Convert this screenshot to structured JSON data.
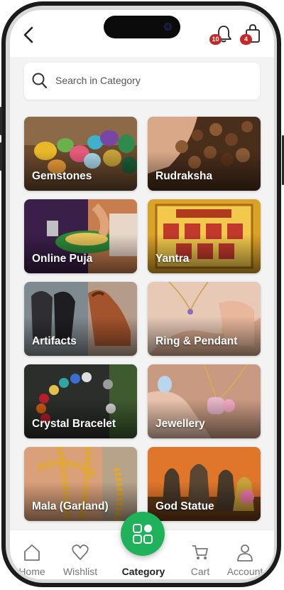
{
  "header": {
    "notification_count": "10",
    "cart_count": "4"
  },
  "search": {
    "placeholder": "Search in Category"
  },
  "categories": [
    {
      "label": "Gemstones",
      "icon": "gemstones-image"
    },
    {
      "label": "Rudraksha",
      "icon": "rudraksha-image"
    },
    {
      "label": "Online Puja",
      "icon": "puja-image"
    },
    {
      "label": "Yantra",
      "icon": "yantra-image"
    },
    {
      "label": "Artifacts",
      "icon": "horses-painting-image"
    },
    {
      "label": "Ring & Pendant",
      "icon": "ring-image"
    },
    {
      "label": "Crystal Bracelet",
      "icon": "bracelet-image"
    },
    {
      "label": "Jewellery",
      "icon": "necklace-image"
    },
    {
      "label": "Mala (Garland)",
      "icon": "mala-image"
    },
    {
      "label": "God Statue",
      "icon": "statue-image"
    }
  ],
  "nav": {
    "home": "Home",
    "wishlist": "Wishlist",
    "category": "Category",
    "cart": "Cart",
    "account": "Account"
  },
  "colors": {
    "accent": "#1fb25a",
    "badge": "#c62828"
  }
}
